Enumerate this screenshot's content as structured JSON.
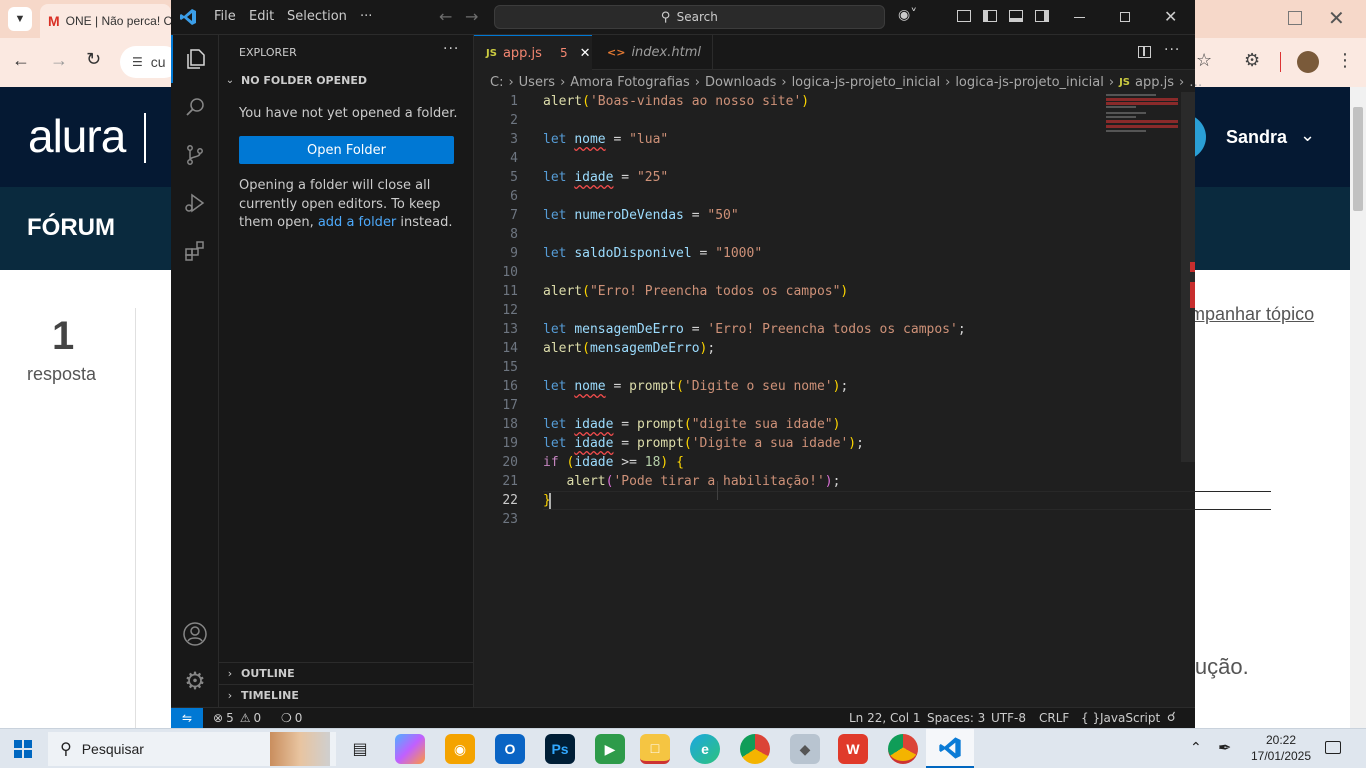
{
  "browser": {
    "tab_title": "ONE | Não perca! C",
    "address_partial": "cu",
    "site": {
      "logo": "alura",
      "forum_label": "FÓRUM",
      "user_name": "Sandra",
      "reply_count": "1",
      "reply_label": "resposta",
      "follow_partial": "mpanhar tópico",
      "solution_partial": "lução."
    }
  },
  "vscode": {
    "menu": [
      "File",
      "Edit",
      "Selection",
      "···"
    ],
    "search_placeholder": "Search",
    "sidebar": {
      "title": "EXPLORER",
      "section": "NO FOLDER OPENED",
      "message": "You have not yet opened a folder.",
      "open_button": "Open Folder",
      "hint_before": "Opening a folder will close all currently open editors. To keep them open, ",
      "hint_link": "add a folder",
      "hint_after": " instead.",
      "outline": "OUTLINE",
      "timeline": "TIMELINE"
    },
    "tabs": [
      {
        "label": "app.js",
        "badge": "5",
        "active": true,
        "icon": "js-icon"
      },
      {
        "label": "index.html",
        "active": false,
        "icon": "html-icon"
      }
    ],
    "breadcrumb": [
      "C:",
      "Users",
      "Amora Fotografias",
      "Downloads",
      "logica-js-projeto_inicial",
      "logica-js-projeto_inicial",
      "app.js",
      "…"
    ],
    "status": {
      "errors": "5",
      "warnings": "0",
      "ports": "0",
      "position": "Ln 22, Col 1",
      "spaces": "Spaces: 3",
      "encoding": "UTF-8",
      "eol": "CRLF",
      "language": "JavaScript"
    },
    "code_lines": [
      "alert('Boas-vindas ao nosso site')",
      "",
      "let nome = \"lua\"",
      "",
      "let idade = \"25\"",
      "",
      "let numeroDeVendas = \"50\"",
      "",
      "let saldoDisponivel = \"1000\"",
      "",
      "alert(\"Erro! Preencha todos os campos\")",
      "",
      "let mensagemDeErro = 'Erro! Preencha todos os campos';",
      "alert(mensagemDeErro);",
      "",
      "let nome = prompt('Digite o seu nome');",
      "",
      "let idade = prompt(\"digite sua idade\")",
      "let idade = prompt('Digite a sua idade');",
      "if (idade >= 18) {",
      "   alert('Pode tirar a habilitação!');",
      "}",
      ""
    ]
  },
  "taskbar": {
    "search_placeholder": "Pesquisar",
    "time": "20:22",
    "date": "17/01/2025"
  }
}
